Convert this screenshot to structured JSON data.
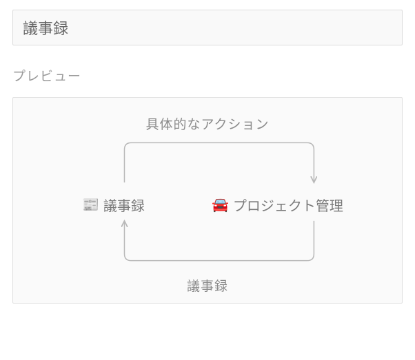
{
  "input": {
    "value": "議事録"
  },
  "preview": {
    "label": "プレビュー",
    "topArrowLabel": "具体的なアクション",
    "bottomArrowLabel": "議事録",
    "leftNode": {
      "icon": "📰",
      "label": "議事録"
    },
    "rightNode": {
      "icon": "🚘",
      "label": "プロジェクト管理"
    }
  }
}
